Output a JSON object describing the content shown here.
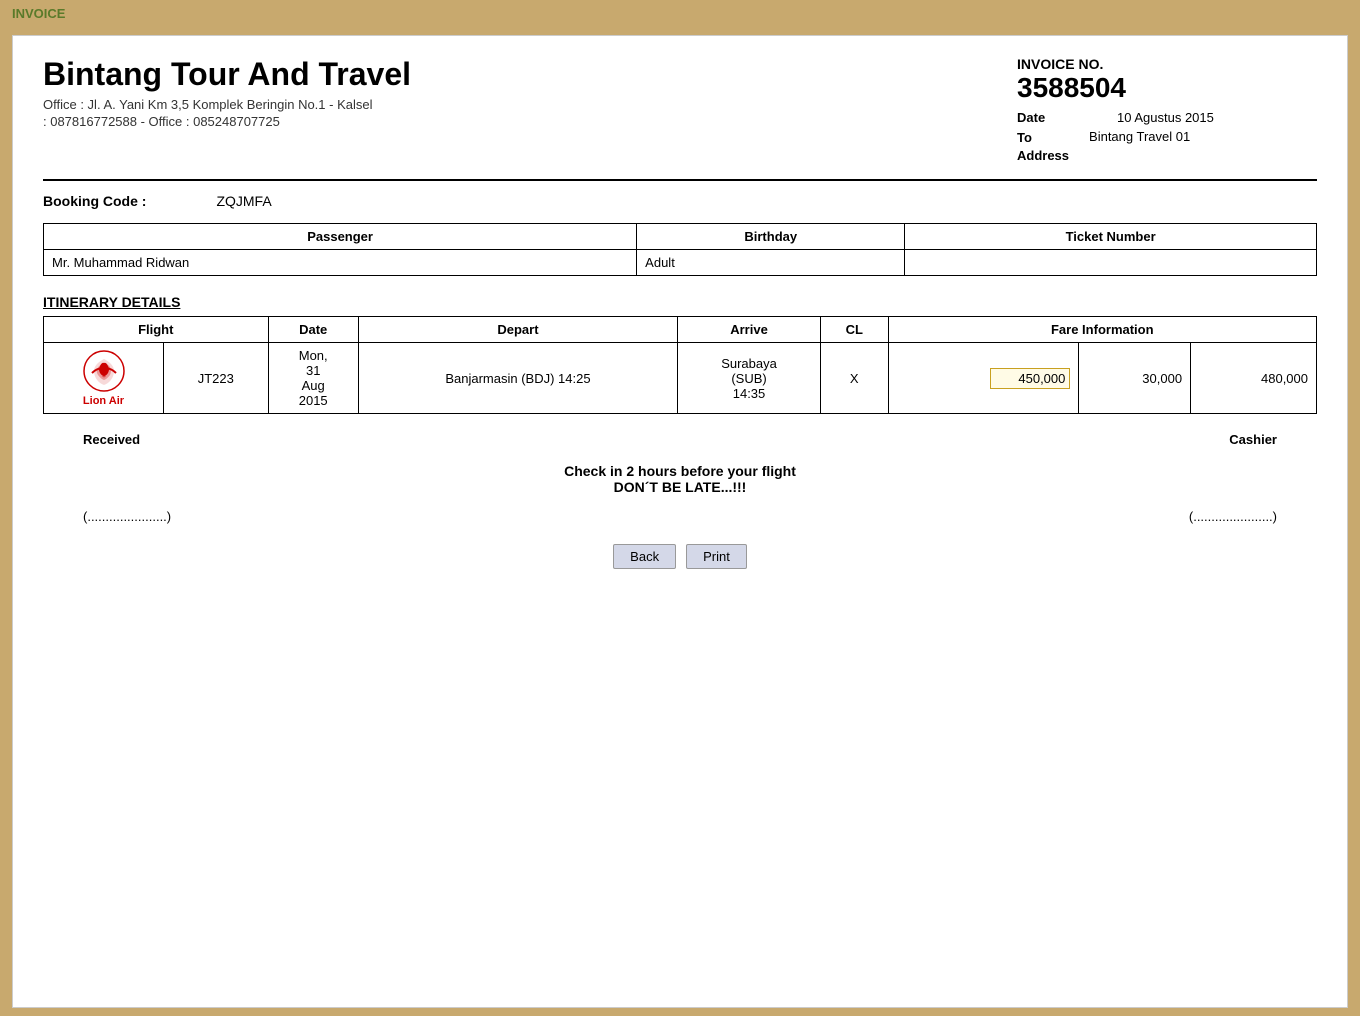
{
  "topBar": {
    "label": "INVOICE"
  },
  "company": {
    "name": "Bintang Tour And Travel",
    "address": "Office : Jl. A. Yani Km 3,5 Komplek Beringin No.1 - Kalsel",
    "phone": ": 087816772588 - Office : 085248707725"
  },
  "invoiceMeta": {
    "noLabel": "INVOICE NO.",
    "noValue": "3588504",
    "dateLabel": "Date",
    "dateValue": "10 Agustus 2015",
    "toAddressLabel": "To\nAddress",
    "toAddressValue": "Bintang Travel 01"
  },
  "booking": {
    "label": "Booking Code :",
    "value": "ZQJMFA"
  },
  "passengerTable": {
    "headers": [
      "Passenger",
      "Birthday",
      "Ticket Number"
    ],
    "rows": [
      [
        "Mr. Muhammad Ridwan",
        "Adult",
        ""
      ]
    ]
  },
  "itinerary": {
    "title": "ITINERARY DETAILS",
    "headers": {
      "flight": "Flight",
      "date": "Date",
      "depart": "Depart",
      "arrive": "Arrive",
      "cl": "CL",
      "fareInfo": "Fare Information"
    },
    "rows": [
      {
        "airlineLogo": "Lion Air",
        "flightNo": "JT223",
        "date": "Mon, 31 Aug 2015",
        "depart": "Banjarmasin (BDJ) 14:25",
        "arrive": "Surabaya (SUB) 14:35",
        "cl": "X",
        "fare1": "450,000",
        "fare2": "30,000",
        "fare3": "480,000"
      }
    ]
  },
  "footer": {
    "received": "Received",
    "cashier": "Cashier"
  },
  "notice": {
    "line1": "Check in 2 hours before your flight",
    "line2": "DON´T BE LATE...!!!"
  },
  "signatures": {
    "left": "(......................)",
    "right": "(......................)"
  },
  "buttons": {
    "back": "Back",
    "print": "Print"
  }
}
